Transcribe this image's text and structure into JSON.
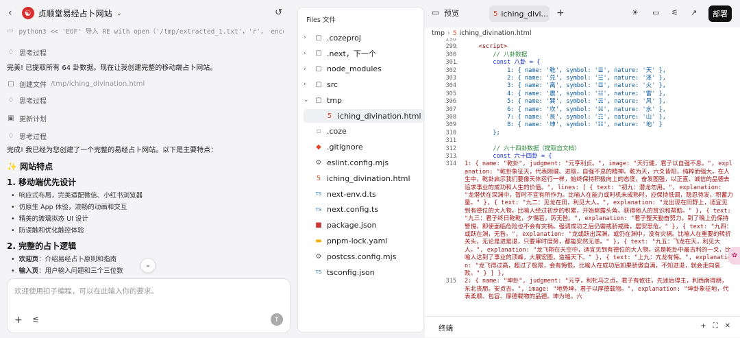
{
  "header": {
    "back_icon": "back-arrow-icon",
    "title": "贞顺堂易经占卜网站",
    "history_icon": "history-icon"
  },
  "chat": {
    "cmd_line": "python3 << 'EOF' 导入 RE with open（'/tmp/extracted_1.txt'，'r'， encodin",
    "thinking_1": "思考过程",
    "msg_1": "完美! 已提取所有 64 卦数据。现在让我创建完整的移动端占卜网站。",
    "create_file_label": "创建文件",
    "create_file_path": "/tmp/iching_divination.html",
    "thinking_2": "思考过程",
    "update_plan": "更新计划",
    "thinking_3": "思考过程",
    "msg_2": "完成! 我已经为您创建了一个完整的易经占卜网站。以下是主要特点：",
    "section_title": "✨ 网站特点",
    "h_mobile": "1. 移动端优先设计",
    "mobile_items": [
      "响应式布局，完美适配微信、小红书浏览器",
      "仿原生 App 体验，流畅的动画和交互",
      "精美的玻璃拟态 UI 设计",
      "防误触和优化触控体验"
    ],
    "h_logic": "2. 完整的占卜逻辑",
    "logic_items": [
      {
        "bold": "欢迎页",
        "text": "：介绍易经占卜原则和指南"
      },
      {
        "bold": "输入页",
        "text": "：用户输入问题和三个三位数"
      }
    ],
    "input_placeholder": "欢迎使用扣子编程，可以在此输入你的要求。"
  },
  "files": {
    "title": "Files 文件",
    "items": [
      {
        "name": ".cozeproj",
        "type": "folder",
        "open": false
      },
      {
        "name": ".next，下一个",
        "type": "folder",
        "open": false
      },
      {
        "name": "node_modules",
        "type": "folder",
        "open": false
      },
      {
        "name": "src",
        "type": "folder",
        "open": false
      },
      {
        "name": "tmp",
        "type": "folder",
        "open": true
      },
      {
        "name": "iching_divination.html",
        "type": "html",
        "child": true,
        "selected": true
      },
      {
        "name": ".coze",
        "type": "file"
      },
      {
        "name": ".gitignore",
        "type": "git"
      },
      {
        "name": "eslint.config.mjs",
        "type": "js"
      },
      {
        "name": "iching_divination.html",
        "type": "html"
      },
      {
        "name": "next-env.d.ts",
        "type": "ts"
      },
      {
        "name": "next.config.ts",
        "type": "ts"
      },
      {
        "name": "package.json",
        "type": "pkg"
      },
      {
        "name": "pnpm-lock.yaml",
        "type": "lock"
      },
      {
        "name": "postcss.config.mjs",
        "type": "js"
      },
      {
        "name": "tsconfig.json",
        "type": "ts"
      }
    ]
  },
  "editor": {
    "tab_preview": "预览",
    "tab_file": "iching_divi...",
    "deploy": "部署",
    "breadcrumb": [
      "tmp",
      "iching_divination.html"
    ],
    "terminal": "终端",
    "lines": [
      {
        "n": "298",
        "t": ""
      },
      {
        "n": "299",
        "t": "    <script>",
        "cls": "tag",
        "fold": true
      },
      {
        "n": "300",
        "t": "        // 八卦数据",
        "cls": "cm"
      },
      {
        "n": "301",
        "t": "        const 八卦 = {",
        "cls": "kw",
        "fold": true
      },
      {
        "n": "302",
        "t": "            1: { name: '乾', symbol: '☰', nature: '天' },"
      },
      {
        "n": "303",
        "t": "            2: { name: '兑', symbol: '☱', nature: '泽' },"
      },
      {
        "n": "304",
        "t": "            3: { name: '离', symbol: '☲', nature: '火' },"
      },
      {
        "n": "305",
        "t": "            4: { name: '震', symbol: '☳', nature: '雷' },"
      },
      {
        "n": "306",
        "t": "            5: { name: '巽', symbol: '☴', nature: '风' },"
      },
      {
        "n": "307",
        "t": "            6: { name: '坎', symbol: '☵', nature: '水' },"
      },
      {
        "n": "308",
        "t": "            7: { name: '艮', symbol: '☶', nature: '山' },"
      },
      {
        "n": "309",
        "t": "            8: { name: '坤', symbol: '☷', nature: '地' }"
      },
      {
        "n": "310",
        "t": "        };"
      },
      {
        "n": "311",
        "t": ""
      },
      {
        "n": "312",
        "t": "        // 六十四卦数据（提取自文档）",
        "cls": "cm"
      },
      {
        "n": "313",
        "t": "        const 六十四卦 = {",
        "cls": "kw",
        "fold": true
      },
      {
        "n": "314",
        "t": "            1: { name: \"乾卦\", judgment: \"元亨利贞。\", image: \"天行健，君子以自强不息。\", explanation: \"乾卦象征天，代表刚健、进取，自强不息的精神。乾为天，六爻皆阳，纯粹而强大。在人生中，乾卦启示我们要像天体运行一样，始终保持积极向上的态度，奋发图强，以正直、诚信的品德去追求事业的成功和人生的价值。\", lines: [ { text: \"初九：潜龙勿用。\", explanation: \"龙潜伏在深渊中，暂时不宜有所作为。比喻人在能力或时机未成熟时，应保持低调，隐忍待发，积蓄力量。\" }, { text: \"九二：见龙在田，利见大人。\", explanation: \"龙出现在田野上，适宜见到有德位的大人物。比喻人经过初步的积累，开始崭露头角，获得他人的赏识和帮助。\" }, { text: \"九三：君子终日乾乾，夕惕若，厉无咎。\", explanation: \"君子整天勤奋努力，到了晚上仍保持警惕，即使面临危险也不会有灾祸。强调成功之后仍需戒骄戒躁，居安思危。\" }, { text: \"九四：或跃在渊，无咎。\", explanation: \"龙或跃出深渊，或仍在渊中，没有灾祸。比喻人在重要的转折关头，无论是进是退，只要审时度势，都能安然无恙。\" }, { text: \"九五：飞龙在天，利见大人。\", explanation: \"龙飞翔在天空中，适宜见到有德位的大人物。这是乾卦中最吉利的一爻，比喻人达到了事业的顶峰，大展宏图，造福天下。\" }, { text: \"上九：亢龙有悔。\", explanation: \"龙飞得过高，超过了极限，会有悔恨。比喻人在成功后如果骄傲自满，不知进退，就会走向衰败。\" } ] },",
        "wrap": true,
        "wrap_lines": 15
      },
      {
        "n": "315",
        "t": "            2: { name: \"坤卦\", judgment: \"元亨，利牝马之贞。君子有攸往，先迷后得主，利西南得朋，东北丧朋。安贞吉。\", image: \"地势坤，君子以厚德载物。\", explanation: \"坤卦象征地，代表柔顺、包容、厚德载物的品德。坤为地，六",
        "wrap": true,
        "wrap_lines": 3
      }
    ]
  }
}
